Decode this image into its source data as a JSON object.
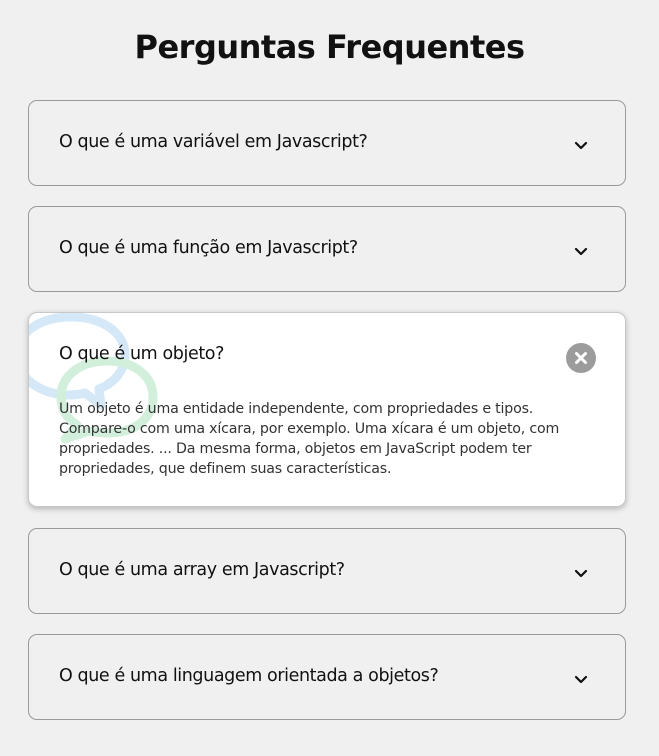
{
  "title": "Perguntas Frequentes",
  "faq": [
    {
      "question": "O que é uma variável em Javascript?",
      "expanded": false,
      "toggle_icon": "chevron-down-icon"
    },
    {
      "question": "O que é uma função em Javascript?",
      "expanded": false,
      "toggle_icon": "chevron-down-icon"
    },
    {
      "question": "O que é um objeto?",
      "expanded": true,
      "toggle_icon": "close-icon",
      "answer_lines": [
        "Um objeto é uma entidade independente, com propriedades e tipos.",
        "Compare-o com uma xícara, por exemplo. Uma xícara é um objeto, com",
        "propriedades. ... Da mesma forma, objetos em JavaScript podem ter",
        "propriedades, que definem suas características."
      ],
      "decoration_icon": "speech-bubbles-icon"
    },
    {
      "question": "O que é uma array em Javascript?",
      "expanded": false,
      "toggle_icon": "chevron-down-icon"
    },
    {
      "question": "O que é uma linguagem orientada a objetos?",
      "expanded": false,
      "toggle_icon": "chevron-down-icon"
    }
  ],
  "colors": {
    "background": "#f0f0f0",
    "card_active": "#ffffff",
    "close_button": "#9c9c9c",
    "bubble_blue": "#cfe6f7",
    "bubble_green": "#cdeed8"
  }
}
